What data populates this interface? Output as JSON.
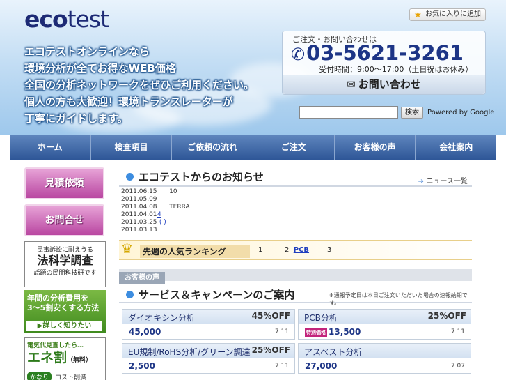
{
  "header": {
    "logo_eco": "eco",
    "logo_test": "test",
    "catch_lines": [
      "エコテストオンラインなら",
      "環境分析が全てお得なWEB価格",
      "全国の分析ネットワークをぜひご利用ください。",
      "個人の方も大歓迎！環境トランスレーターが",
      "丁寧にガイドします。"
    ],
    "favorite_label": "お気に入りに追加",
    "contact": {
      "heading": "ご注文・お問い合わせは",
      "phone": "03-5621-3261",
      "hours": "受付時間：9:00～17:00（土日祝はお休み）",
      "inquiry_label": "お問い合わせ"
    },
    "search": {
      "placeholder": "",
      "button_label": "検索",
      "powered_by": "Powered by Google"
    }
  },
  "nav": {
    "items": [
      "ホーム",
      "検査項目",
      "ご依頼の流れ",
      "ご注文",
      "お客様の声",
      "会社案内"
    ]
  },
  "sidebar": {
    "estimate_label": "見積依頼",
    "contact_label": "お問合せ",
    "law_banner": {
      "line1": "民事訴訟に耐えうる",
      "line2": "法科学調査",
      "line3": "話題の民間科捜研です"
    },
    "cost_banner": {
      "line1": "年間の分析費用を",
      "line2": "3～5割安くする方法",
      "detail_label": "▶詳しく知りたい"
    },
    "ene_banner": {
      "line1": "電気代見直したら…",
      "line2": "エネ割",
      "line2_small": "（無料）",
      "line3": "かなり",
      "line4": "コスト削減"
    }
  },
  "news": {
    "title": "エコテストからのお知らせ",
    "more_label": "ニュース一覧",
    "items": [
      {
        "date": "2011.06.15",
        "text": "10",
        "link": ""
      },
      {
        "date": "2011.05.09",
        "text": "",
        "link": "                                "
      },
      {
        "date": "2011.04.08",
        "text": "TERRA",
        "link": ""
      },
      {
        "date": "2011.04.01",
        "text": "",
        "link": "4                                   "
      },
      {
        "date": "2011.03.25",
        "text": "",
        "link": "              (       )           "
      },
      {
        "date": "2011.03.13",
        "text": "",
        "link": ""
      }
    ]
  },
  "ranking": {
    "title": "先週の人気ランキング",
    "items": [
      {
        "rank": "1",
        "label": "      "
      },
      {
        "rank": "2",
        "label": "PCB  "
      },
      {
        "rank": "3",
        "label": "              "
      }
    ]
  },
  "voice_tab_label": "お客様の声",
  "services": {
    "title": "サービス＆キャンペーンのご案内",
    "note": "※通報予定日は本日ご注文いただいた場合の速報納期です。",
    "special_badge": "特別価格",
    "cards": [
      {
        "name": "ダイオキシン分析",
        "off": "45%OFF",
        "price": "45,000",
        "code": "7 11",
        "special": false
      },
      {
        "name": "PCB分析",
        "off": "25%OFF",
        "price": "13,500",
        "code": "7 11",
        "special": true
      },
      {
        "name": "EU規制/RoHS分析/グリーン調達",
        "off": "25%OFF",
        "price": "2,500",
        "code": "7 11",
        "special": false
      },
      {
        "name": "アスベスト分析",
        "off": "",
        "price": "27,000",
        "code": "7 07",
        "special": false
      }
    ]
  }
}
